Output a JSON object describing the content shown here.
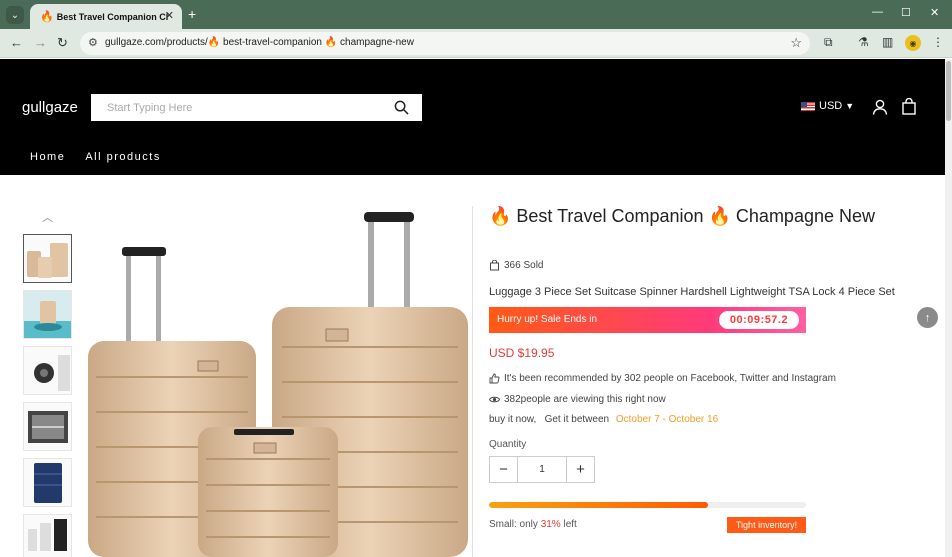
{
  "browser": {
    "tab_title": "Best Travel Companion Champagne New",
    "tab_favicon": "🔥",
    "url": "gullgaze.com/products/🔥 best-travel-companion 🔥 champagne-new"
  },
  "store": {
    "logo": "gullgaze",
    "search_placeholder": "Start Typing Here",
    "currency": "USD",
    "nav": [
      "Home",
      "All products"
    ]
  },
  "product": {
    "title": "🔥 Best Travel Companion 🔥 Champagne New",
    "sold": "366 Sold",
    "subtitle": "Luggage 3 Piece Set Suitcase Spinner Hardshell Lightweight TSA Lock 4 Piece Set",
    "sale_text": "Hurry up! Sale Ends in",
    "timer": "00:09:57.2",
    "price": "USD $19.95",
    "recommend": "It's been recommended by 302 people on Facebook, Twitter and Instagram",
    "viewing": "382people are viewing this right now",
    "delivery_prefix": "buy it now,   Get it between ",
    "delivery_dates": "October 7 - October 16",
    "quantity_label": "Quantity",
    "quantity": "1",
    "stock_prefix": "Small: only ",
    "stock_percent": "31%",
    "stock_suffix": " left",
    "stock_fill": 0.69,
    "tight_badge": "Tight inventory!"
  },
  "colors": {
    "header_bg": "#000000",
    "price": "#e53935",
    "accent_orange": "#ff5a16",
    "luggage": "#e3c7a8"
  },
  "icons": [
    "search-icon",
    "user-icon",
    "cart-icon",
    "thumbs-up-icon",
    "eye-icon",
    "bag-icon",
    "arrow-up-icon",
    "chevron-up-icon"
  ]
}
